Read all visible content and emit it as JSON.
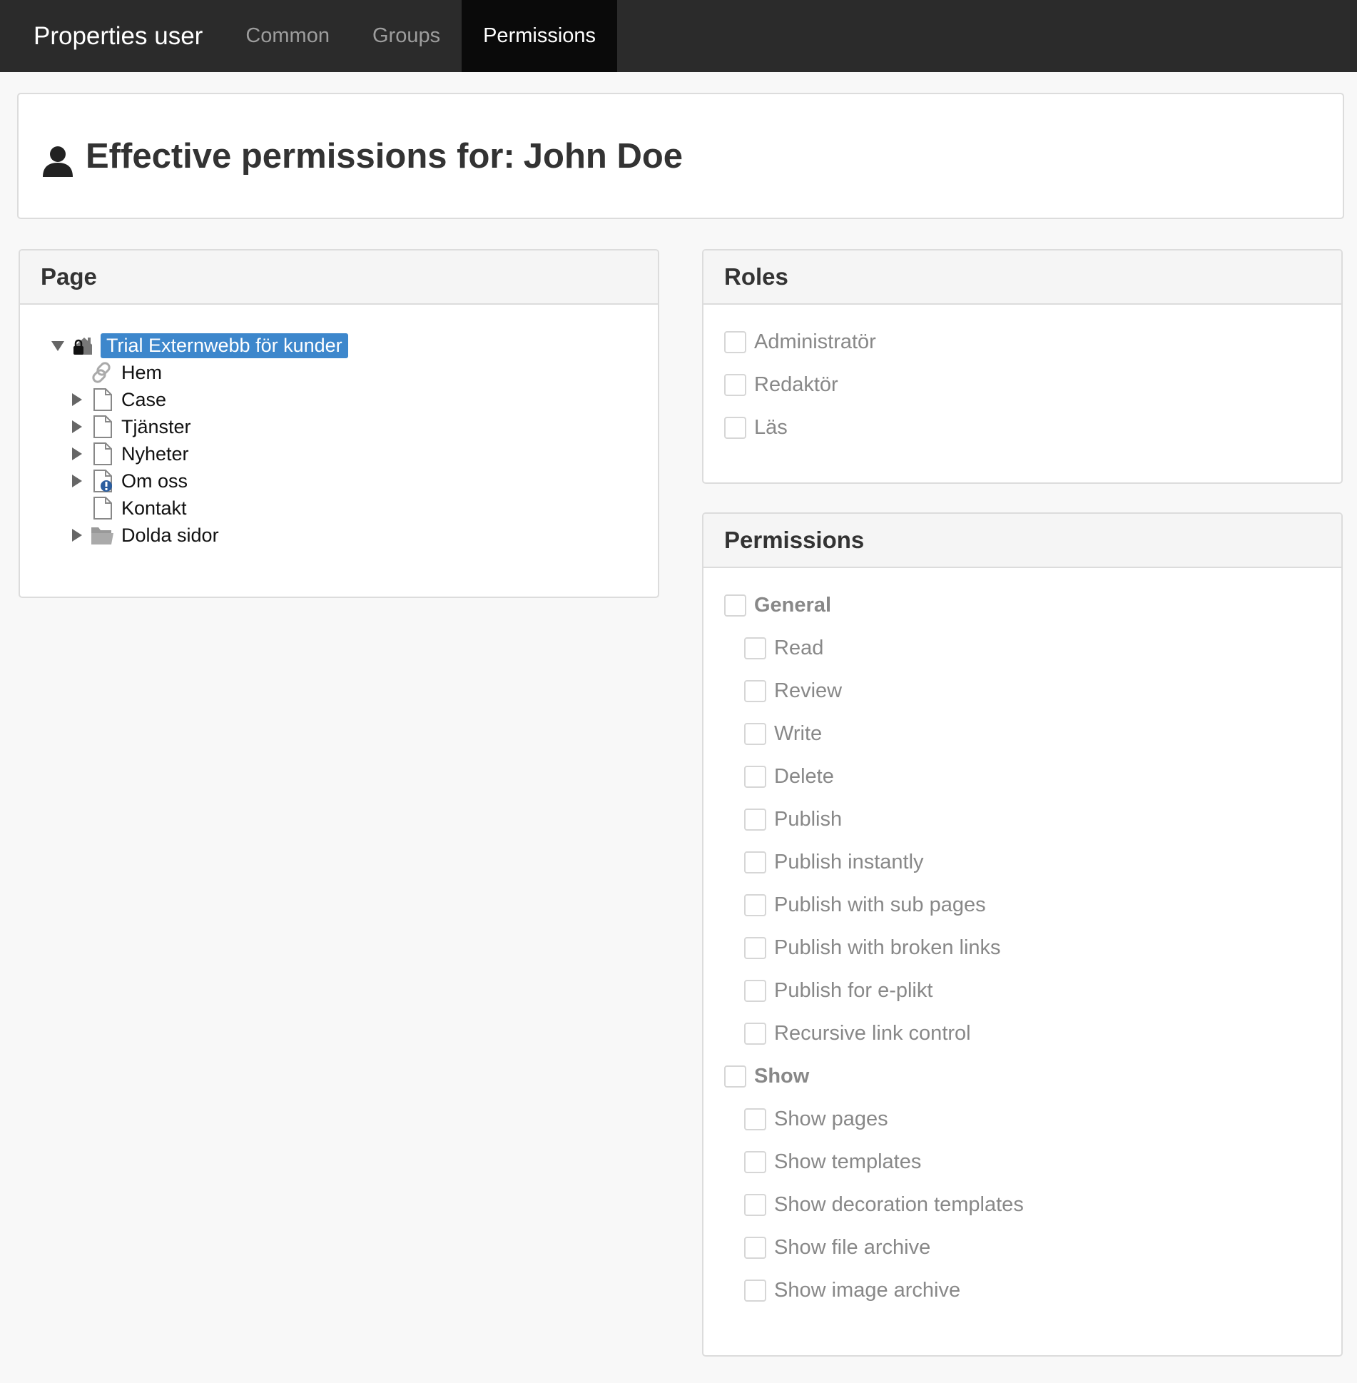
{
  "nav": {
    "brand": "Properties user",
    "tabs": [
      {
        "label": "Common",
        "active": false
      },
      {
        "label": "Groups",
        "active": false
      },
      {
        "label": "Permissions",
        "active": true
      }
    ]
  },
  "header": {
    "label": "Effective permissions for:",
    "user_name": "John Doe",
    "icon": "user-icon"
  },
  "page_panel": {
    "title": "Page",
    "tree": [
      {
        "label": "Trial Externwebb för kunder",
        "icon": "site-lock-icon",
        "toggle": "expanded",
        "selected": true
      },
      {
        "label": "Hem",
        "icon": "link-icon",
        "toggle": "none"
      },
      {
        "label": "Case",
        "icon": "page-icon",
        "toggle": "collapsed"
      },
      {
        "label": "Tjänster",
        "icon": "page-icon",
        "toggle": "collapsed"
      },
      {
        "label": "Nyheter",
        "icon": "page-icon",
        "toggle": "collapsed"
      },
      {
        "label": "Om oss",
        "icon": "page-info-icon",
        "toggle": "collapsed"
      },
      {
        "label": "Kontakt",
        "icon": "page-icon",
        "toggle": "none"
      },
      {
        "label": "Dolda sidor",
        "icon": "folder-icon",
        "toggle": "collapsed"
      }
    ]
  },
  "roles_panel": {
    "title": "Roles",
    "items": [
      "Administratör",
      "Redaktör",
      "Läs"
    ]
  },
  "permissions_panel": {
    "title": "Permissions",
    "general": {
      "label": "General",
      "items": [
        "Read",
        "Review",
        "Write",
        "Delete",
        "Publish",
        "Publish instantly",
        "Publish with sub pages",
        "Publish with broken links",
        "Publish for e-plikt",
        "Recursive link control"
      ]
    },
    "show": {
      "label": "Show",
      "items": [
        "Show pages",
        "Show templates",
        "Show decoration templates",
        "Show file archive",
        "Show image archive"
      ]
    }
  },
  "colors": {
    "nav_bg": "#2b2b2b",
    "nav_active_bg": "#0a0a0a",
    "selection": "#3d87cc"
  }
}
